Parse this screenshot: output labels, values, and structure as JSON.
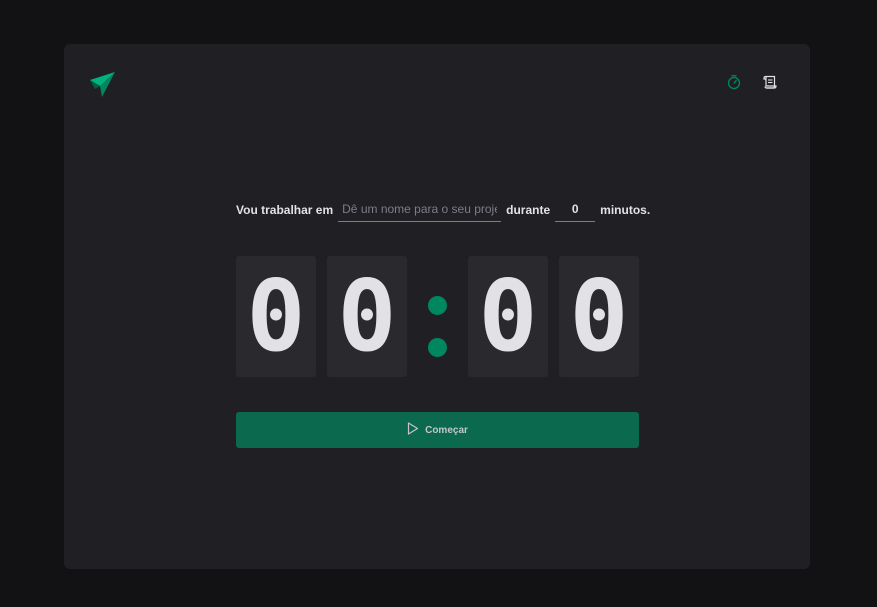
{
  "nav": {
    "timer_icon": "timer-icon",
    "history_icon": "scroll-icon",
    "active_color": "#00875f"
  },
  "form": {
    "label_prefix": "Vou trabalhar em",
    "task_placeholder": "Dê um nome para o seu projeto",
    "task_value": "",
    "label_middle": "durante",
    "minutes_value": "0",
    "label_suffix": "minutos."
  },
  "countdown": {
    "minutes_tens": "0",
    "minutes_ones": "0",
    "seconds_tens": "0",
    "seconds_ones": "0"
  },
  "start_button": {
    "label": "Começar",
    "icon": "play-icon"
  },
  "colors": {
    "accent": "#00875f",
    "button": "#0b6a4d",
    "background": "#121214",
    "panel": "#202024",
    "digit_bg": "#29292e",
    "text": "#e1e1e6"
  }
}
